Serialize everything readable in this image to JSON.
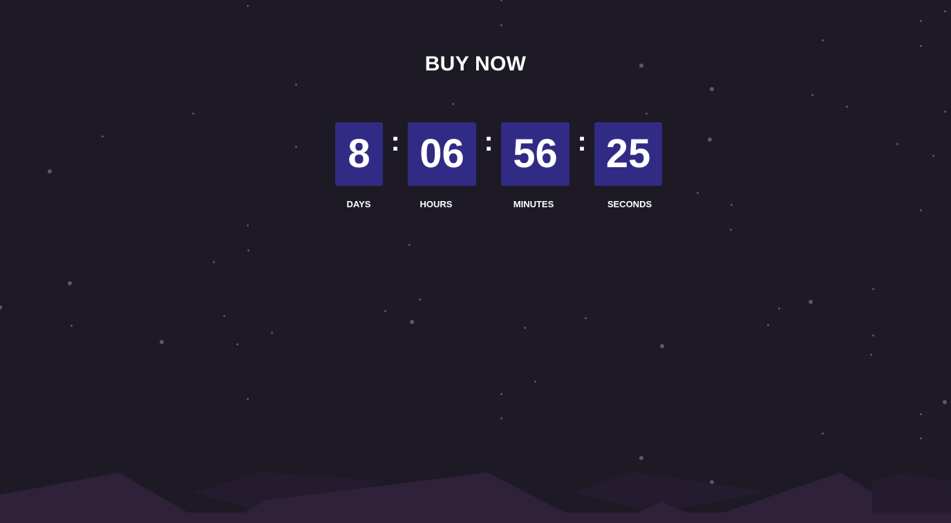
{
  "headline": "BUY NOW",
  "countdown": {
    "days": {
      "value": "8",
      "label": "DAYS"
    },
    "hours": {
      "value": "06",
      "label": "HOURS"
    },
    "minutes": {
      "value": "56",
      "label": "MINUTES"
    },
    "seconds": {
      "value": "25",
      "label": "SECONDS"
    },
    "separator": ":"
  },
  "colors": {
    "background": "#1d1a25",
    "box": "#322b85",
    "text": "#ffffff",
    "hill_front": "#2e2139",
    "hill_back": "#241c2e",
    "star": "#5c5967"
  }
}
